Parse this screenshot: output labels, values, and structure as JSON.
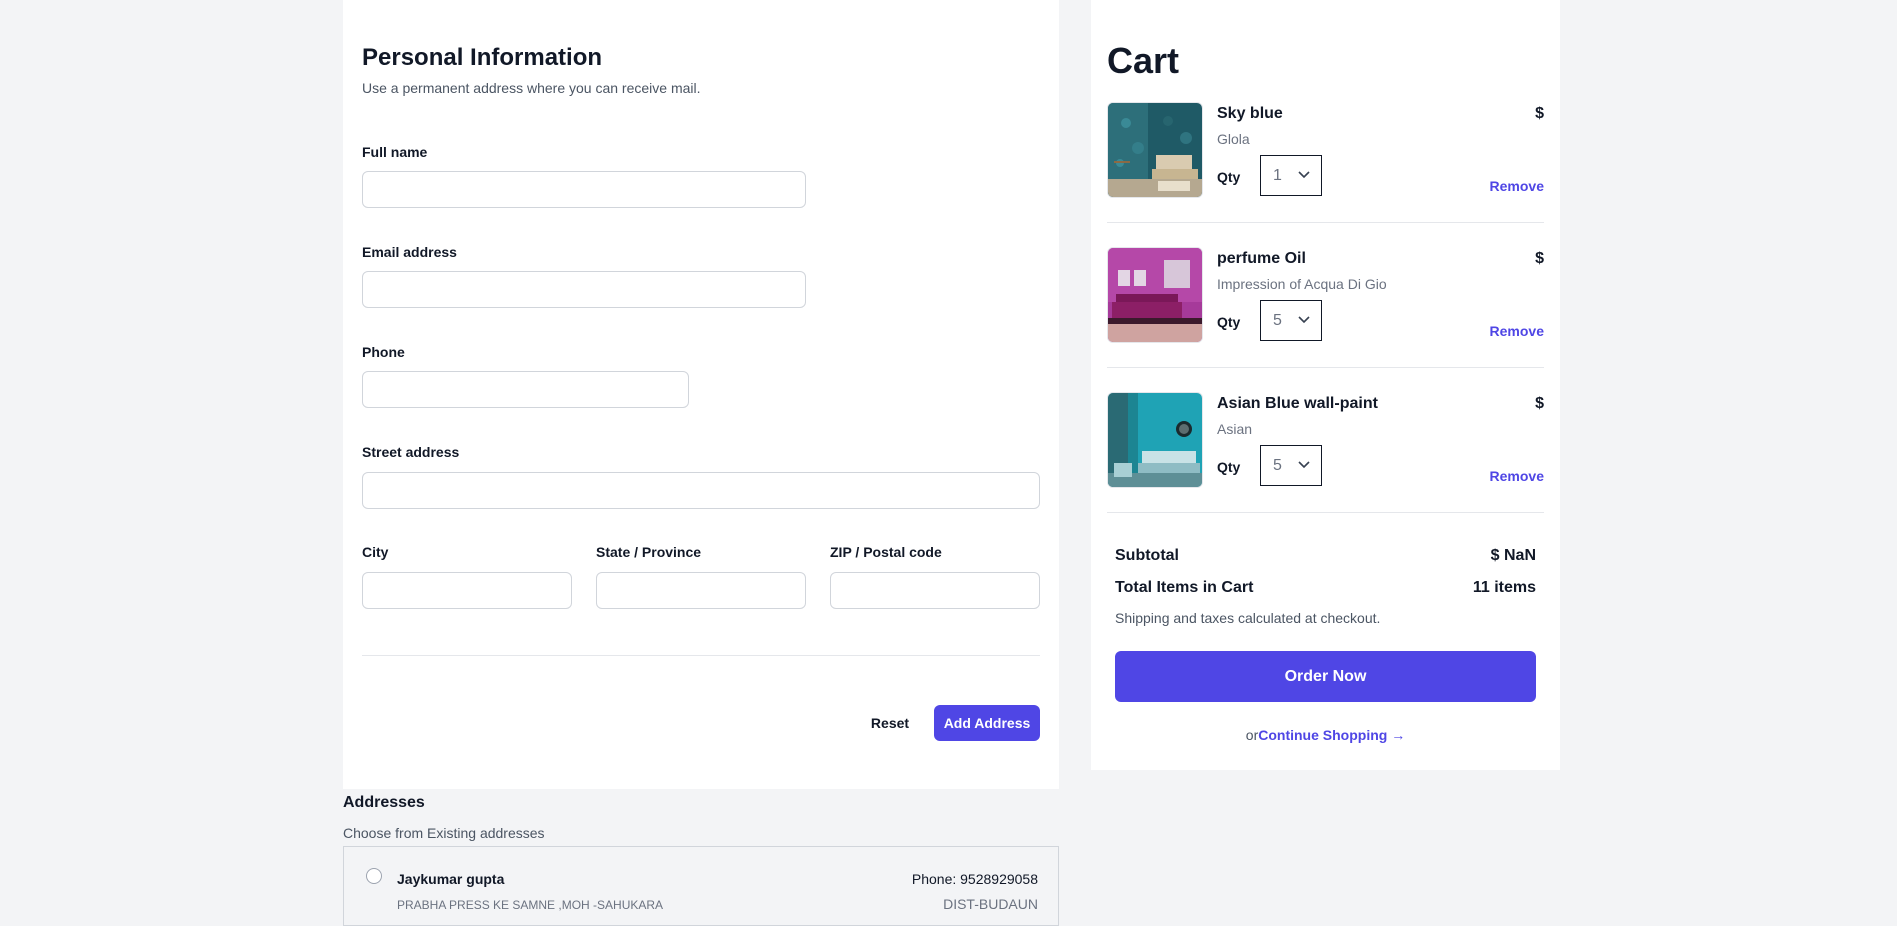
{
  "form": {
    "title": "Personal Information",
    "subtitle": "Use a permanent address where you can receive mail.",
    "fields": {
      "full_name": {
        "label": "Full name",
        "value": ""
      },
      "email": {
        "label": "Email address",
        "value": ""
      },
      "phone": {
        "label": "Phone",
        "value": ""
      },
      "street": {
        "label": "Street address",
        "value": ""
      },
      "city": {
        "label": "City",
        "value": ""
      },
      "state": {
        "label": "State / Province",
        "value": ""
      },
      "zip": {
        "label": "ZIP / Postal code",
        "value": ""
      }
    },
    "reset_label": "Reset",
    "add_label": "Add Address"
  },
  "addresses": {
    "title": "Addresses",
    "subtitle": "Choose from Existing addresses",
    "items": [
      {
        "name": "Jaykumar gupta",
        "street": "PRABHA PRESS KE SAMNE ,MOH -SAHUKARA",
        "phone": "Phone: 9528929058",
        "city": "DIST-BUDAUN"
      }
    ]
  },
  "cart": {
    "title": "Cart",
    "qty_label": "Qty",
    "remove_label": "Remove",
    "items": [
      {
        "name": "Sky blue",
        "brand": "Glola",
        "price": "$",
        "qty": "1"
      },
      {
        "name": "perfume Oil",
        "brand": "Impression of Acqua Di Gio",
        "price": "$",
        "qty": "5"
      },
      {
        "name": "Asian Blue wall-paint",
        "brand": "Asian",
        "price": "$",
        "qty": "5"
      }
    ],
    "subtotal_label": "Subtotal",
    "subtotal_value": "$ NaN",
    "total_items_label": "Total Items in Cart",
    "total_items_value": "11 items",
    "shipping_note": "Shipping and taxes calculated at checkout.",
    "order_label": "Order Now",
    "or_text": "or",
    "continue_label": "Continue Shopping →"
  },
  "colors": {
    "accent": "#4f46e5",
    "background": "#f3f4f6",
    "card": "#ffffff"
  }
}
